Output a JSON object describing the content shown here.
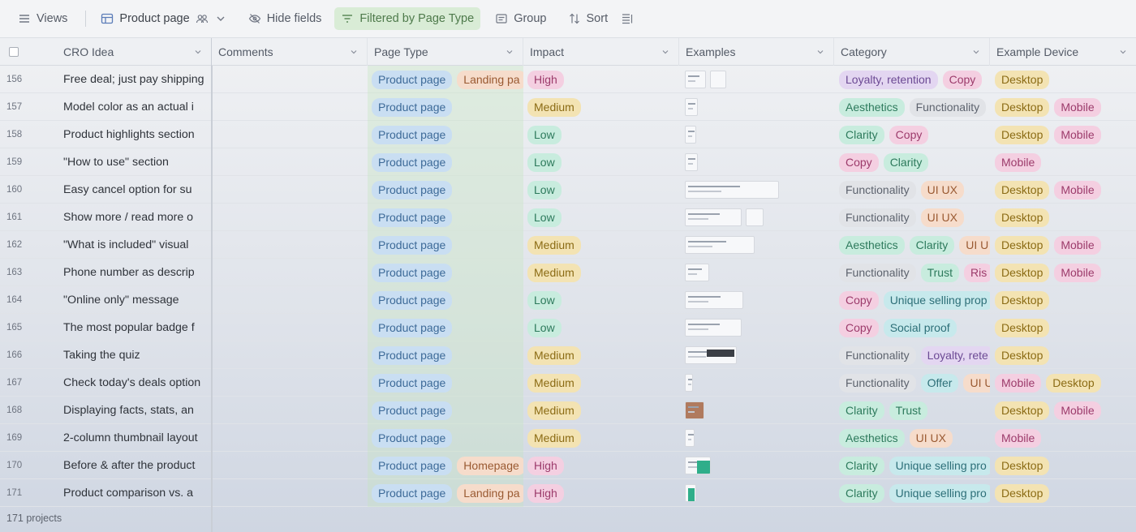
{
  "toolbar": {
    "views_label": "Views",
    "view_name": "Product page",
    "hide_fields_label": "Hide fields",
    "filter_label": "Filtered by Page Type",
    "group_label": "Group",
    "sort_label": "Sort"
  },
  "columns": [
    "CRO Idea",
    "Comments",
    "Page Type",
    "Impact",
    "Examples",
    "Category",
    "Example Device"
  ],
  "rows": [
    {
      "num": "156",
      "idea": "Free deal; just pay shipping",
      "page": [
        "Product page",
        "Landing pa"
      ],
      "impact": "High",
      "cat": [
        "Loyalty, retention",
        "Copy"
      ],
      "dev": [
        "Desktop"
      ]
    },
    {
      "num": "157",
      "idea": "Model color as an actual i",
      "page": [
        "Product page"
      ],
      "impact": "Medium",
      "cat": [
        "Aesthetics",
        "Functionality"
      ],
      "dev": [
        "Desktop",
        "Mobile"
      ]
    },
    {
      "num": "158",
      "idea": "Product highlights section",
      "page": [
        "Product page"
      ],
      "impact": "Low",
      "cat": [
        "Clarity",
        "Copy"
      ],
      "dev": [
        "Desktop",
        "Mobile"
      ]
    },
    {
      "num": "159",
      "idea": "\"How to use\" section",
      "page": [
        "Product page"
      ],
      "impact": "Low",
      "cat": [
        "Copy",
        "Clarity"
      ],
      "dev": [
        "Mobile"
      ]
    },
    {
      "num": "160",
      "idea": "Easy cancel option for su",
      "page": [
        "Product page"
      ],
      "impact": "Low",
      "cat": [
        "Functionality",
        "UI UX"
      ],
      "dev": [
        "Desktop",
        "Mobile"
      ]
    },
    {
      "num": "161",
      "idea": "Show more / read more o",
      "page": [
        "Product page"
      ],
      "impact": "Low",
      "cat": [
        "Functionality",
        "UI UX"
      ],
      "dev": [
        "Desktop"
      ]
    },
    {
      "num": "162",
      "idea": "\"What is included\" visual",
      "page": [
        "Product page"
      ],
      "impact": "Medium",
      "cat": [
        "Aesthetics",
        "Clarity",
        "UI U"
      ],
      "dev": [
        "Desktop",
        "Mobile"
      ]
    },
    {
      "num": "163",
      "idea": "Phone number as descrip",
      "page": [
        "Product page"
      ],
      "impact": "Medium",
      "cat": [
        "Functionality",
        "Trust",
        "Ris"
      ],
      "dev": [
        "Desktop",
        "Mobile"
      ]
    },
    {
      "num": "164",
      "idea": "\"Online only\" message",
      "page": [
        "Product page"
      ],
      "impact": "Low",
      "cat": [
        "Copy",
        "Unique selling prop"
      ],
      "dev": [
        "Desktop"
      ]
    },
    {
      "num": "165",
      "idea": "The most popular badge f",
      "page": [
        "Product page"
      ],
      "impact": "Low",
      "cat": [
        "Copy",
        "Social proof"
      ],
      "dev": [
        "Desktop"
      ]
    },
    {
      "num": "166",
      "idea": "Taking the quiz",
      "page": [
        "Product page"
      ],
      "impact": "Medium",
      "cat": [
        "Functionality",
        "Loyalty, rete"
      ],
      "dev": [
        "Desktop"
      ]
    },
    {
      "num": "167",
      "idea": "Check today's deals option",
      "page": [
        "Product page"
      ],
      "impact": "Medium",
      "cat": [
        "Functionality",
        "Offer",
        "UI U"
      ],
      "dev": [
        "Mobile",
        "Desktop"
      ]
    },
    {
      "num": "168",
      "idea": "Displaying facts, stats, an",
      "page": [
        "Product page"
      ],
      "impact": "Medium",
      "cat": [
        "Clarity",
        "Trust"
      ],
      "dev": [
        "Desktop",
        "Mobile"
      ]
    },
    {
      "num": "169",
      "idea": "2-column thumbnail layout",
      "page": [
        "Product page"
      ],
      "impact": "Medium",
      "cat": [
        "Aesthetics",
        "UI UX"
      ],
      "dev": [
        "Mobile"
      ]
    },
    {
      "num": "170",
      "idea": "Before & after the product",
      "page": [
        "Product page",
        "Homepage"
      ],
      "impact": "High",
      "cat": [
        "Clarity",
        "Unique selling pro"
      ],
      "dev": [
        "Desktop"
      ]
    },
    {
      "num": "171",
      "idea": "Product comparison vs. a",
      "page": [
        "Product page",
        "Landing pa"
      ],
      "impact": "High",
      "cat": [
        "Clarity",
        "Unique selling pro"
      ],
      "dev": [
        "Desktop"
      ]
    }
  ],
  "footer": {
    "count_label": "171 projects"
  },
  "colors": {
    "Product page": "blue",
    "Landing pa": "peach",
    "Homepage": "peach",
    "High": "pink",
    "Medium": "yellow",
    "Low": "green",
    "Loyalty, retention": "purple",
    "Loyalty, rete": "purple",
    "Copy": "pink",
    "Aesthetics": "green",
    "Functionality": "grey",
    "Clarity": "green",
    "UI UX": "peach",
    "UI U": "peach",
    "Trust": "green",
    "Ris": "pink",
    "Unique selling prop": "teal",
    "Unique selling pro": "teal",
    "Social proof": "teal",
    "Offer": "teal",
    "Desktop": "yellow",
    "Mobile": "pink"
  }
}
